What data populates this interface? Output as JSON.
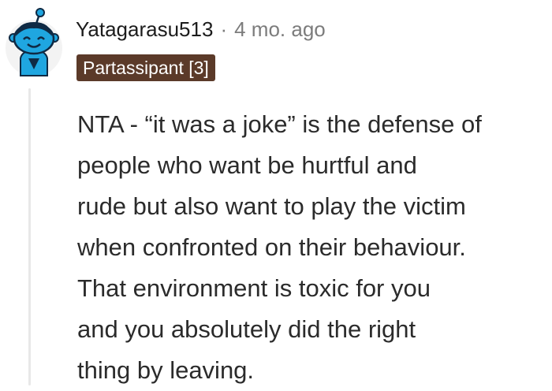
{
  "comment": {
    "author": "Yatagarasu513",
    "separator": "·",
    "age": "4 mo. ago",
    "flair": "Partassipant [3]",
    "body_lines": [
      "NTA - “it was a joke” is the defense of",
      "people who want be hurtful and",
      "rude but also want to play the victim",
      "when confronted on their behaviour.",
      "That environment is toxic for you",
      "and you absolutely did the right",
      "thing by leaving."
    ]
  },
  "avatar": {
    "icon": "snoo-avatar-icon",
    "body_color": "#1fa6e0",
    "circle_color": "#f3f3f3",
    "outline_color": "#0f2a44"
  },
  "colors": {
    "flair_bg": "#5b3a29",
    "flair_text": "#ffffff",
    "thread_line": "#e8e8e8",
    "meta_text": "#7c7c7c"
  }
}
